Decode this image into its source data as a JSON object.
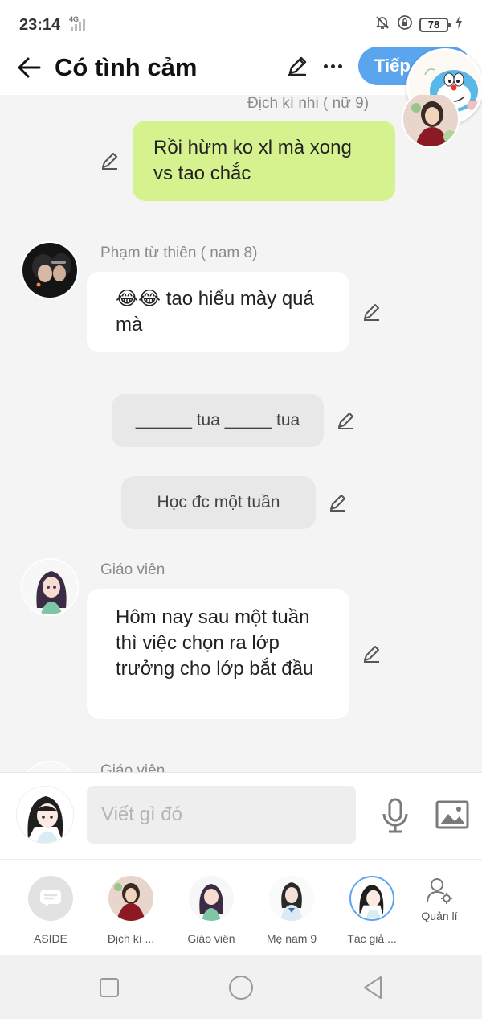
{
  "status_bar": {
    "time": "23:14",
    "network": "4G",
    "battery": "78"
  },
  "app_bar": {
    "title": "Có tình cảm",
    "next_label": "Tiếp"
  },
  "messages": [
    {
      "sender": "Địch kì nhi ( nữ 9)",
      "text": "Rồi hừm ko xl  mà xong vs tao chắc"
    },
    {
      "sender": "Phạm từ thiên ( nam 8)",
      "text": "😂😂 tao hiểu mày quá mà"
    },
    {
      "text": "______ tua _____ tua"
    },
    {
      "text": "Học đc một tuần"
    },
    {
      "sender": "Giáo viên",
      "text": "Hôm nay sau một tuần thì việc chọn ra lớp trưởng cho lớp bắt đầu"
    },
    {
      "sender": "Giáo viên"
    }
  ],
  "composer": {
    "placeholder": "Viết gì đó"
  },
  "characters": [
    {
      "label": "ASIDE"
    },
    {
      "label": "Địch kì ..."
    },
    {
      "label": "Giáo viên"
    },
    {
      "label": "Mẹ nam 9"
    },
    {
      "label": "Tác giả ..."
    }
  ],
  "manage": {
    "label": "Quản lí"
  },
  "colors": {
    "accent": "#5aa5ee",
    "own_bubble": "#d6f28e",
    "other_bubble": "#ffffff",
    "narration_bubble": "#e8e8e8"
  }
}
